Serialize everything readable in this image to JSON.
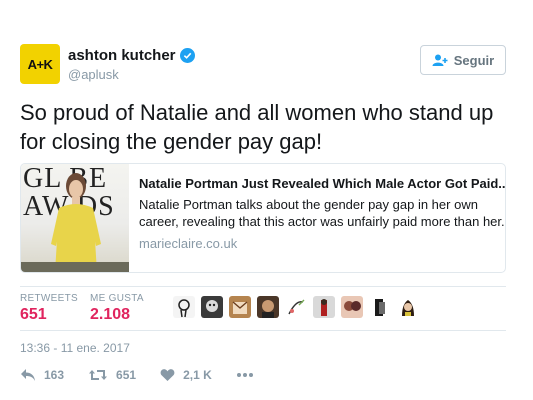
{
  "author": {
    "display_name": "ashton kutcher",
    "handle": "@aplusk",
    "avatar_text": "A+K",
    "avatar_color": "#f2d200",
    "verified": true
  },
  "follow_button": {
    "label": "Seguir",
    "icon": "add-user-icon"
  },
  "tweet": {
    "text": "So proud of Natalie and all women who stand up for closing the gender pay gap!",
    "timestamp": "13:36 - 11 ene. 2017"
  },
  "card": {
    "image_text_line1": "GL  BE",
    "image_text_line2": "AW   DS",
    "title": "Natalie Portman Just Revealed Which Male Actor Got Paid...",
    "description": "Natalie Portman talks about the gender pay gap in her own career, revealing that this actor was unfairly paid more than her.",
    "domain": "marieclaire.co.uk"
  },
  "stats": {
    "retweets_label": "RETWEETS",
    "retweets_value": "651",
    "likes_label": "ME GUSTA",
    "likes_value": "2.108"
  },
  "actions": {
    "reply_count": "163",
    "retweet_count": "651",
    "like_count": "2,1 K",
    "more_icon": "more-dots-icon"
  },
  "colors": {
    "accent": "#1da1f2",
    "like": "#e0245e",
    "muted": "#8899a6",
    "border": "#e1e8ed"
  }
}
